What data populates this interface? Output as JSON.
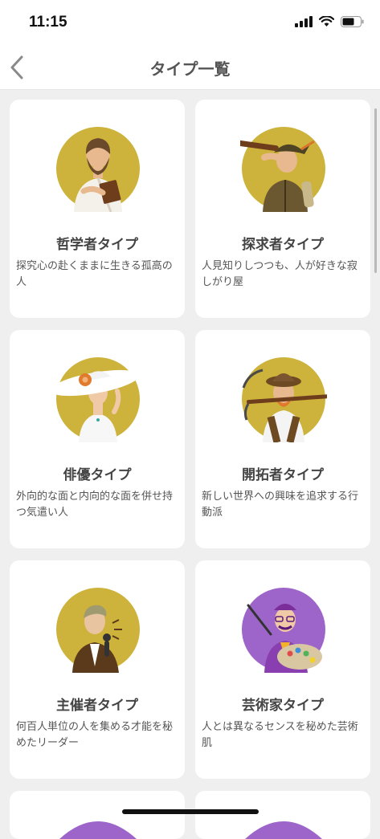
{
  "status_bar": {
    "time": "11:15"
  },
  "header": {
    "title": "タイプ一覧"
  },
  "colors": {
    "mustard": "#cdb33b",
    "purple": "#9d65c9",
    "card_bg": "#ffffff",
    "page_bg": "#efefef"
  },
  "types": [
    {
      "title": "哲学者タイプ",
      "description": "探究心の赴くままに生きる孤高の人",
      "icon": "philosopher-illustration"
    },
    {
      "title": "探求者タイプ",
      "description": "人見知りしつつも、人が好きな寂しがり屋",
      "icon": "explorer-illustration"
    },
    {
      "title": "俳優タイプ",
      "description": "外向的な面と内向的な面を併せ持つ気遣い人",
      "icon": "actor-illustration"
    },
    {
      "title": "開拓者タイプ",
      "description": "新しい世界への興味を追求する行動派",
      "icon": "pioneer-illustration"
    },
    {
      "title": "主催者タイプ",
      "description": "何百人単位の人を集める才能を秘めたリーダー",
      "icon": "organizer-illustration"
    },
    {
      "title": "芸術家タイプ",
      "description": "人とは異なるセンスを秘めた芸術肌",
      "icon": "artist-illustration"
    }
  ]
}
